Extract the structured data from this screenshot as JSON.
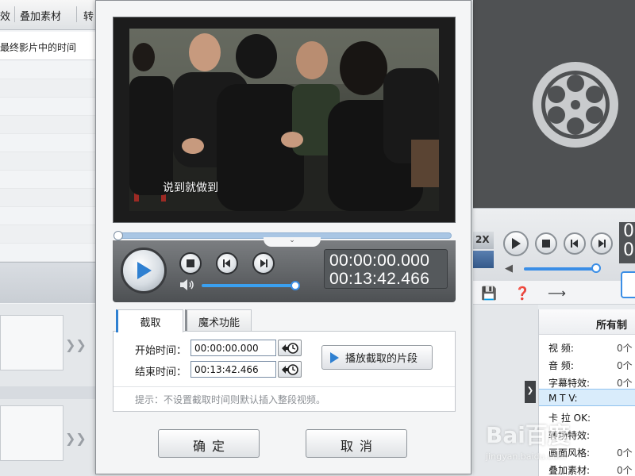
{
  "background_app": {
    "tabs": [
      "效",
      "叠加素材",
      "转"
    ],
    "column_header": "最终影片中的时间",
    "speed_label": "2X",
    "stats_title": "所有制",
    "stats": [
      {
        "key": "视    频:",
        "value": "0个"
      },
      {
        "key": "音    频:",
        "value": "0个"
      },
      {
        "key": "字幕特效:",
        "value": "0个"
      },
      {
        "key": "M  T  V:",
        "value": ""
      },
      {
        "key": "卡  拉  OK:",
        "value": ""
      },
      {
        "key": "转场特效:",
        "value": ""
      },
      {
        "key": "画面风格:",
        "value": "0个"
      },
      {
        "key": "叠加素材:",
        "value": "0个"
      }
    ],
    "partial_time": "0"
  },
  "dialog": {
    "subtitle": "说到就做到",
    "timecode_current": "00:00:00.000",
    "timecode_total": "00:13:42.466",
    "seek_progress": 0.0,
    "volume_level": 0.95,
    "tabs": {
      "capture": "截取",
      "magic": "魔术功能"
    },
    "start_label": "开始时间：",
    "start_value": "00:00:00.000",
    "end_label": "结束时间：",
    "end_value": "00:13:42.466",
    "play_clip_label": "播放截取的片段",
    "hint": "提示：不设置截取时间则默认插入整段视频。",
    "ok_label": "确定",
    "cancel_label": "取消"
  },
  "colors": {
    "accent": "#2f80d1",
    "player_bar": "#5f6265",
    "highlight_row": "#d9ecfb"
  },
  "icons": [
    "play-icon",
    "stop-icon",
    "previous-frame-icon",
    "next-frame-icon",
    "volume-icon",
    "pick-time-icon",
    "film-reel-icon",
    "save-icon",
    "help-icon",
    "share-icon"
  ],
  "watermark": {
    "text": "Bai百度",
    "subtext": "jingyan.baidu.com"
  }
}
